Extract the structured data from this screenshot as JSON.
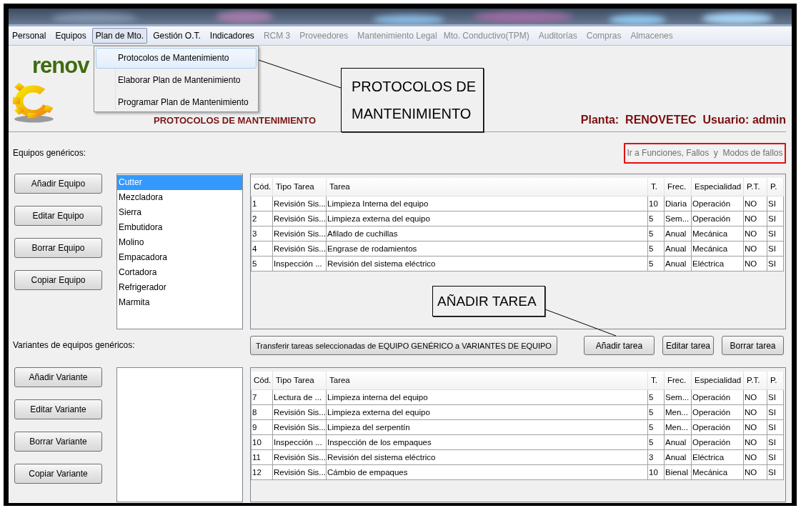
{
  "menu_bar": [
    {
      "label": "Personal",
      "enabled": true,
      "open": false
    },
    {
      "label": "Equipos",
      "enabled": true,
      "open": false
    },
    {
      "label": "Plan de Mto.",
      "enabled": true,
      "open": true
    },
    {
      "label": "Gestión O.T.",
      "enabled": true,
      "open": false
    },
    {
      "label": "Indicadores",
      "enabled": true,
      "open": false
    },
    {
      "label": "RCM 3",
      "enabled": false,
      "open": false
    },
    {
      "label": "Proveedores",
      "enabled": false,
      "open": false
    },
    {
      "label": "Mantenimiento Legal",
      "enabled": false,
      "open": false
    },
    {
      "label": "Mto. Conductivo(TPM)",
      "enabled": false,
      "open": false
    },
    {
      "label": "Auditorías",
      "enabled": false,
      "open": false
    },
    {
      "label": "Compras",
      "enabled": false,
      "open": false
    },
    {
      "label": "Almacenes",
      "enabled": false,
      "open": false
    }
  ],
  "dropdown_menu": [
    {
      "label": "Protocolos de Mantenimiento",
      "selected": true
    },
    {
      "label": "Elaborar Plan de Mantenimiento",
      "selected": false
    },
    {
      "label": "Programar Plan de Mantenimiento",
      "selected": false
    }
  ],
  "logo": {
    "text": "renov"
  },
  "page_heading": "PROTOCOLOS DE MANTENIMIENTO",
  "plant_user": "Planta:  RENOVETEC  Usuario: admin",
  "failure_modes_button": "Ir a Funciones, Fallos  y  Modos de fallos",
  "generic_equipment": {
    "label": "Equipos genéricos:",
    "buttons": [
      "Añadir Equipo",
      "Editar Equipo",
      "Borrar Equipo",
      "Copiar Equipo"
    ],
    "items": [
      {
        "label": "Cutter",
        "selected": true
      },
      {
        "label": "Mezcladora",
        "selected": false
      },
      {
        "label": "Sierra",
        "selected": false
      },
      {
        "label": "Embutidora",
        "selected": false
      },
      {
        "label": "Molino",
        "selected": false
      },
      {
        "label": "Empacadora",
        "selected": false
      },
      {
        "label": "Cortadora",
        "selected": false
      },
      {
        "label": "Refrigerador",
        "selected": false
      },
      {
        "label": "Marmita",
        "selected": false
      }
    ],
    "table": {
      "columns": [
        "Cód.",
        "Tipo Tarea",
        "Tarea",
        "T.",
        "Frec.",
        "Especialidad",
        "P.T.",
        "P."
      ],
      "rows": [
        [
          "1",
          "Revisión Sis...",
          "Limpieza Interna del equipo",
          "10",
          "Diaria",
          "Operación",
          "NO",
          "SI"
        ],
        [
          "2",
          "Revisión Sis...",
          "Limpieza externa del equipo",
          "5",
          "Sem...",
          "Operación",
          "NO",
          "SI"
        ],
        [
          "3",
          "Revisión Sis...",
          "Afilado de cuchillas",
          "5",
          "Anual",
          "Mecánica",
          "NO",
          "SI"
        ],
        [
          "4",
          "Revisión Sis...",
          "Engrase de rodamientos",
          "5",
          "Anual",
          "Mecánica",
          "NO",
          "SI"
        ],
        [
          "5",
          "Inspección ...",
          "Revisión del sistema eléctrico",
          "5",
          "Anual",
          "Eléctrica",
          "NO",
          "SI"
        ]
      ]
    }
  },
  "task_buttons": {
    "transfer": "Transferir tareas seleccionadas de EQUIPO GENÉRICO a VARIANTES DE EQUIPO",
    "actions": [
      "Añadir tarea",
      "Editar tarea",
      "Borrar tarea"
    ]
  },
  "variants": {
    "label": "Variantes de equipos genéricos:",
    "buttons": [
      "Añadir Variante",
      "Editar Variante",
      "Borrar Variante",
      "Copiar Variante"
    ],
    "table": {
      "columns": [
        "Cód.",
        "Tipo Tarea",
        "Tarea",
        "T.",
        "Frec.",
        "Especialidad",
        "P.T.",
        "P."
      ],
      "rows": [
        [
          "7",
          "Lectura de ...",
          "Limpieza interna del equipo",
          "5",
          "Sem...",
          "Operación",
          "NO",
          "SI"
        ],
        [
          "8",
          "Revisión Sis...",
          "Limpieza externa del equipo",
          "5",
          "Men...",
          "Operación",
          "NO",
          "SI"
        ],
        [
          "9",
          "Revisión Sis...",
          "Limpieza del serpentín",
          "5",
          "Men...",
          "Operación",
          "NO",
          "SI"
        ],
        [
          "10",
          "Inspección ...",
          "Inspección de los empaques",
          "5",
          "Anual",
          "Operación",
          "NO",
          "SI"
        ],
        [
          "11",
          "Revisión Sis...",
          "Revisión del sistema eléctrico",
          "3",
          "Anual",
          "Eléctrica",
          "NO",
          "SI"
        ],
        [
          "12",
          "Revisión Sis...",
          "Cámbio de empaques",
          "10",
          "Bienal",
          "Mecánica",
          "NO",
          "SI"
        ]
      ]
    }
  },
  "callouts": [
    {
      "text": "PROTOCOLOS DE MANTENIMIENTO"
    },
    {
      "text": "AÑADIR TAREA"
    }
  ]
}
